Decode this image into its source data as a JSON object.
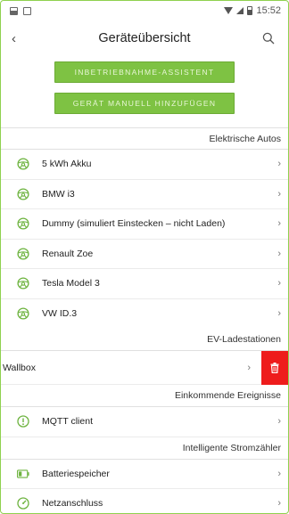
{
  "status_bar": {
    "time": "15:52"
  },
  "app_bar": {
    "back_glyph": "‹",
    "title": "Geräteübersicht"
  },
  "actions": {
    "assistant_label": "INBETRIEBNAHME-ASSISTENT",
    "add_manual_label": "GERÄT MANUELL HINZUFÜGEN"
  },
  "sections": {
    "cars": {
      "header": "Elektrische Autos",
      "items": [
        {
          "label": "5 kWh Akku",
          "icon": "steering-wheel-icon"
        },
        {
          "label": "BMW i3",
          "icon": "steering-wheel-icon"
        },
        {
          "label": "Dummy (simuliert Einstecken – nicht Laden)",
          "icon": "steering-wheel-icon"
        },
        {
          "label": "Renault Zoe",
          "icon": "steering-wheel-icon"
        },
        {
          "label": "Tesla Model 3",
          "icon": "steering-wheel-icon"
        },
        {
          "label": "VW ID.3",
          "icon": "steering-wheel-icon"
        }
      ]
    },
    "chargers": {
      "header": "EV-Ladestationen",
      "items": [
        {
          "label": "Wallbox",
          "action_icon": "trash-icon"
        }
      ]
    },
    "events": {
      "header": "Einkommende Ereignisse",
      "items": [
        {
          "label": "MQTT client",
          "icon": "alert-circle-icon"
        }
      ]
    },
    "meters": {
      "header": "Intelligente Stromzähler",
      "items": [
        {
          "label": "Batteriespeicher",
          "icon": "battery-icon"
        },
        {
          "label": "Netzanschluss",
          "icon": "gauge-icon"
        }
      ]
    }
  },
  "chevron": "›",
  "colors": {
    "accent": "#7ec243",
    "delete": "#ee1c1c",
    "icon_green": "#6db33f"
  }
}
